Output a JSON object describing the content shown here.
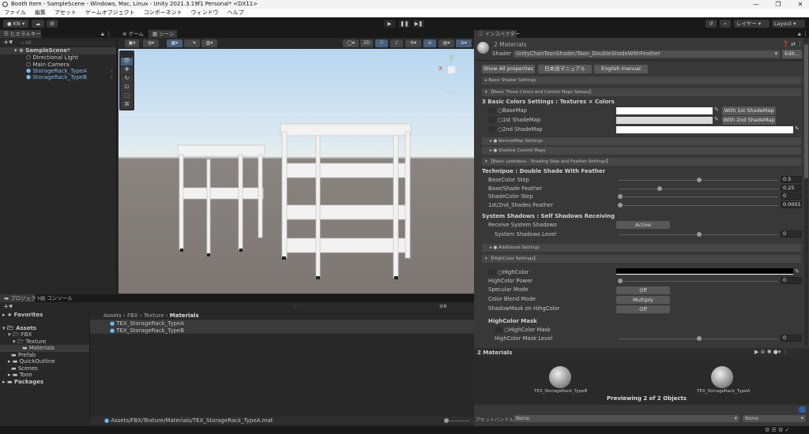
{
  "window": {
    "title": "Booth Item - SampleScene - Windows, Mac, Linux - Unity 2021.3.19f1 Personal* <DX11>",
    "controls": [
      "—",
      "❐",
      "✕"
    ]
  },
  "menu": [
    "ファイル",
    "編集",
    "アセット",
    "ゲームオブジェクト",
    "コンポーネント",
    "ウィンドウ",
    "ヘルプ"
  ],
  "toolbar": {
    "account": "KN ▾",
    "layers": "レイヤー",
    "layout": "Layout"
  },
  "hierarchy": {
    "tab": "ヒエラルキー",
    "search_placeholder": "All",
    "items": [
      {
        "label": "SampleScene*"
      },
      {
        "label": "Directional Light"
      },
      {
        "label": "Main Camera"
      },
      {
        "label": "StorageRack_TypeA"
      },
      {
        "label": "StorageRack_TypeB"
      }
    ]
  },
  "scene": {
    "tabs": [
      "ゲーム",
      "シーン"
    ],
    "mode_2d": "2D",
    "view": "Persp",
    "gizmo_axes": [
      "y",
      "x"
    ]
  },
  "project": {
    "tabs": [
      "プロジェクト",
      "コンソール"
    ],
    "badge": "6",
    "tree": [
      {
        "label": "Favorites"
      },
      {
        "label": "Assets"
      },
      {
        "label": "FBX"
      },
      {
        "label": "Texture"
      },
      {
        "label": "Materials"
      },
      {
        "label": "Prefab"
      },
      {
        "label": "QuickOutline"
      },
      {
        "label": "Scenes"
      },
      {
        "label": "Toon"
      },
      {
        "label": "Packages"
      }
    ],
    "breadcrumb": [
      "Assets",
      "FBX",
      "Texture",
      "Materials"
    ],
    "files": [
      "TEX_StorageRack_TypeA",
      "TEX_StorageRack_TypeB"
    ],
    "path": "Assets/FBX/Texture/Materials/TEX_StorageRack_TypeA.mat"
  },
  "inspector": {
    "tab": "インスペクター",
    "title": "2 Materials",
    "shader_label": "Shader",
    "shader": "UnityChanToonShader/Toon_DoubleShadeWithFeather",
    "edit": "Edit...",
    "buttons": [
      "Show All properties",
      "日本語マニュアル",
      "English manual"
    ],
    "folds": {
      "basic": "Basic Shader Settings",
      "three": "【Basic Three Colors and Control Maps Setups】",
      "normal": "NormalMap Settings",
      "shadow": "Shadow Control Maps",
      "lookdev": "【Basic Lookdevs : Shading Step and Feather Settings】",
      "additional": "Additional Settings",
      "highcolor": "【HighColor Settings】"
    },
    "colors_heading": "3 Basic Colors Settings : Textures × Colors",
    "maps": [
      {
        "label": "BaseMap",
        "button": "With 1st ShadeMap",
        "color": "#ffffff"
      },
      {
        "label": "1st ShadeMap",
        "button": "With 2nd ShadeMap",
        "color": "#d9d9d9"
      },
      {
        "label": "2nd ShadeMap",
        "color": "#ffffff"
      }
    ],
    "technique_heading": "Technipue : Double Shade With Feather",
    "sliders": [
      {
        "label": "BaseColor Step",
        "value": "0.5",
        "fraction": 0.5
      },
      {
        "label": "Base/Shade Feather",
        "value": "0.25",
        "fraction": 0.25
      },
      {
        "label": "ShadeColor Step",
        "value": "0",
        "fraction": 0
      },
      {
        "label": "1st/2nd_Shades Feather",
        "value": "0.0001",
        "fraction": 0
      }
    ],
    "shadows_heading": "System Shadows : Self Shadows Receiving",
    "receive_label": "Receive System Shadows",
    "receive_value": "Active",
    "shadow_level": {
      "label": "System Shadows Level",
      "value": "0",
      "fraction": 0.5
    },
    "highcolor": {
      "label": "HighColor",
      "color": "#000000"
    },
    "highcolor_power": {
      "label": "HighColor Power",
      "value": "0",
      "fraction": 0
    },
    "enums": [
      {
        "label": "Specular Mode",
        "value": "Off"
      },
      {
        "label": "Color Blend Mode",
        "value": "Multiply"
      },
      {
        "label": "ShadowMask on HihgColor",
        "value": "Off"
      }
    ],
    "mask_heading": "HighColor Mask",
    "mask_label": "HighColor Mask",
    "mask_level": {
      "label": "HighColor Mask Level",
      "value": "0",
      "fraction": 0.5
    },
    "preview_title": "2 Materials",
    "previews": [
      "TEX_StorageRack_TypeB",
      "TEX_StorageRack_TypeA"
    ],
    "preview_status": "Previewing 2 of 2 Objects",
    "assetbundle_label": "アセットバンドル",
    "assetbundle": "None",
    "variant": "None"
  }
}
